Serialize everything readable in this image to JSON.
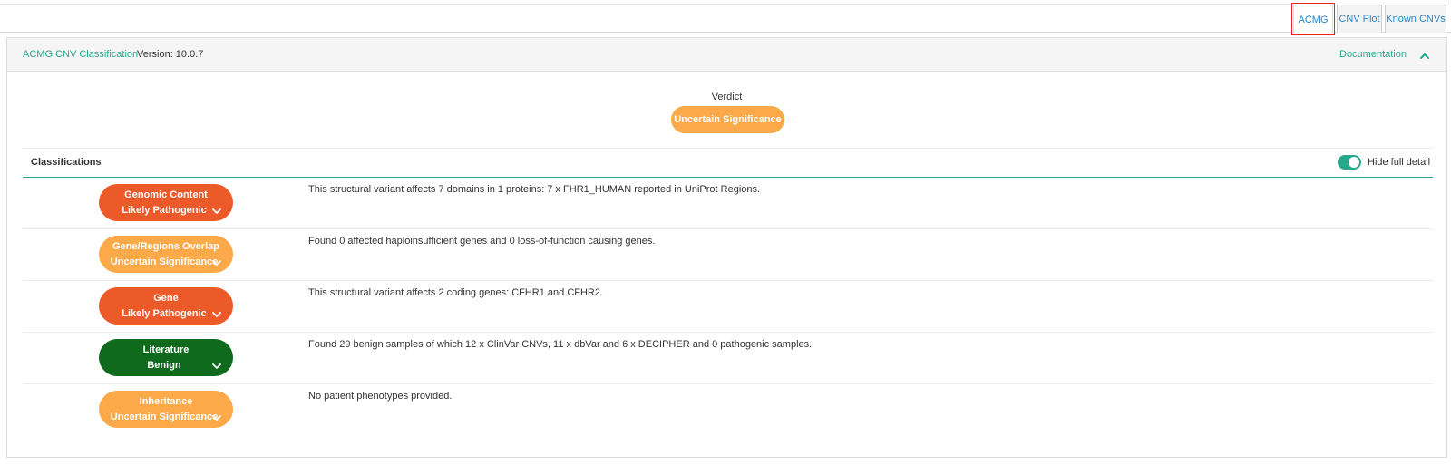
{
  "tabs": [
    {
      "label": "ACMG",
      "active": true
    },
    {
      "label": "CNV Plot",
      "active": false
    },
    {
      "label": "Known CNVs",
      "active": false
    }
  ],
  "header": {
    "title": "ACMG CNV Classification",
    "version": "Version: 10.0.7",
    "documentation": "Documentation"
  },
  "verdict": {
    "label": "Verdict",
    "value": "Uncertain Significance"
  },
  "classifications": {
    "title": "Classifications",
    "toggle_label": "Hide full detail",
    "toggle_on": true,
    "rows": [
      {
        "category": "Genomic Content",
        "result": "Likely Pathogenic",
        "color": "#ed5a29",
        "description": "This structural variant affects 7 domains in 1 proteins: 7 x FHR1_HUMAN reported in UniProt Regions."
      },
      {
        "category": "Gene/Regions Overlap",
        "result": "Uncertain Significance",
        "color": "#fca94a",
        "description": "Found 0 affected haploinsufficient genes and 0 loss-of-function causing genes."
      },
      {
        "category": "Gene",
        "result": "Likely Pathogenic",
        "color": "#ed5a29",
        "description": "This structural variant affects 2 coding genes: CFHR1 and CFHR2."
      },
      {
        "category": "Literature",
        "result": "Benign",
        "color": "#0f6a1e",
        "description": "Found 29 benign samples of which 12 x ClinVar CNVs, 11 x dbVar and 6 x DECIPHER and 0 pathogenic samples."
      },
      {
        "category": "Inheritance",
        "result": "Uncertain Significance",
        "color": "#fca94a",
        "description": "No patient phenotypes provided."
      }
    ]
  },
  "colors": {
    "accent": "#27a88b",
    "link_blue": "#2a87c9",
    "highlight_red": "#e8232b"
  }
}
